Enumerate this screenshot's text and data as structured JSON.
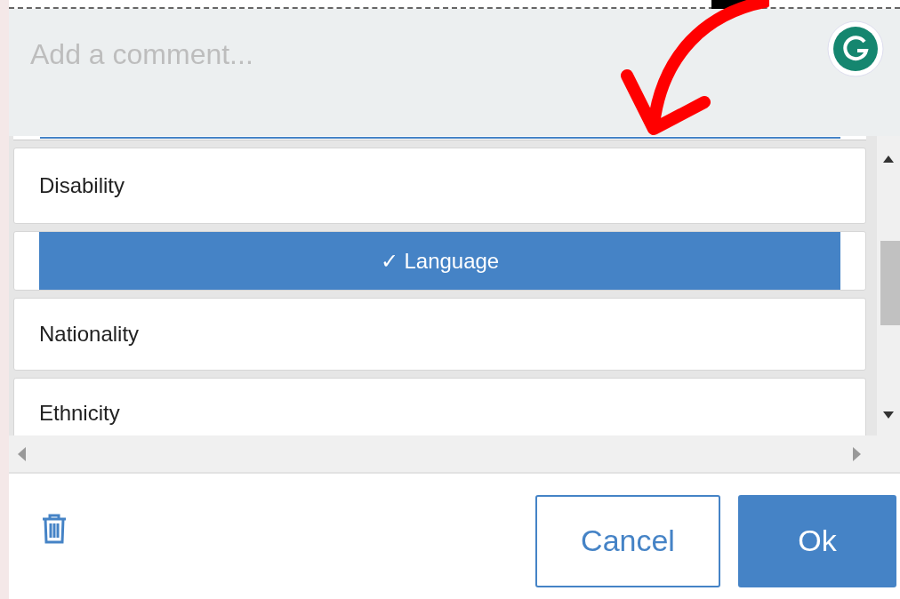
{
  "comment": {
    "placeholder": "Add a comment..."
  },
  "options": [
    {
      "label": "Disability",
      "selected": false
    },
    {
      "label": "Language",
      "selected": true
    },
    {
      "label": "Nationality",
      "selected": false
    },
    {
      "label": "Ethnicity",
      "selected": false
    }
  ],
  "check_mark": "✓",
  "buttons": [
    {
      "label": "Cancel",
      "kind": "secondary"
    },
    {
      "label": "Ok",
      "kind": "primary"
    }
  ]
}
